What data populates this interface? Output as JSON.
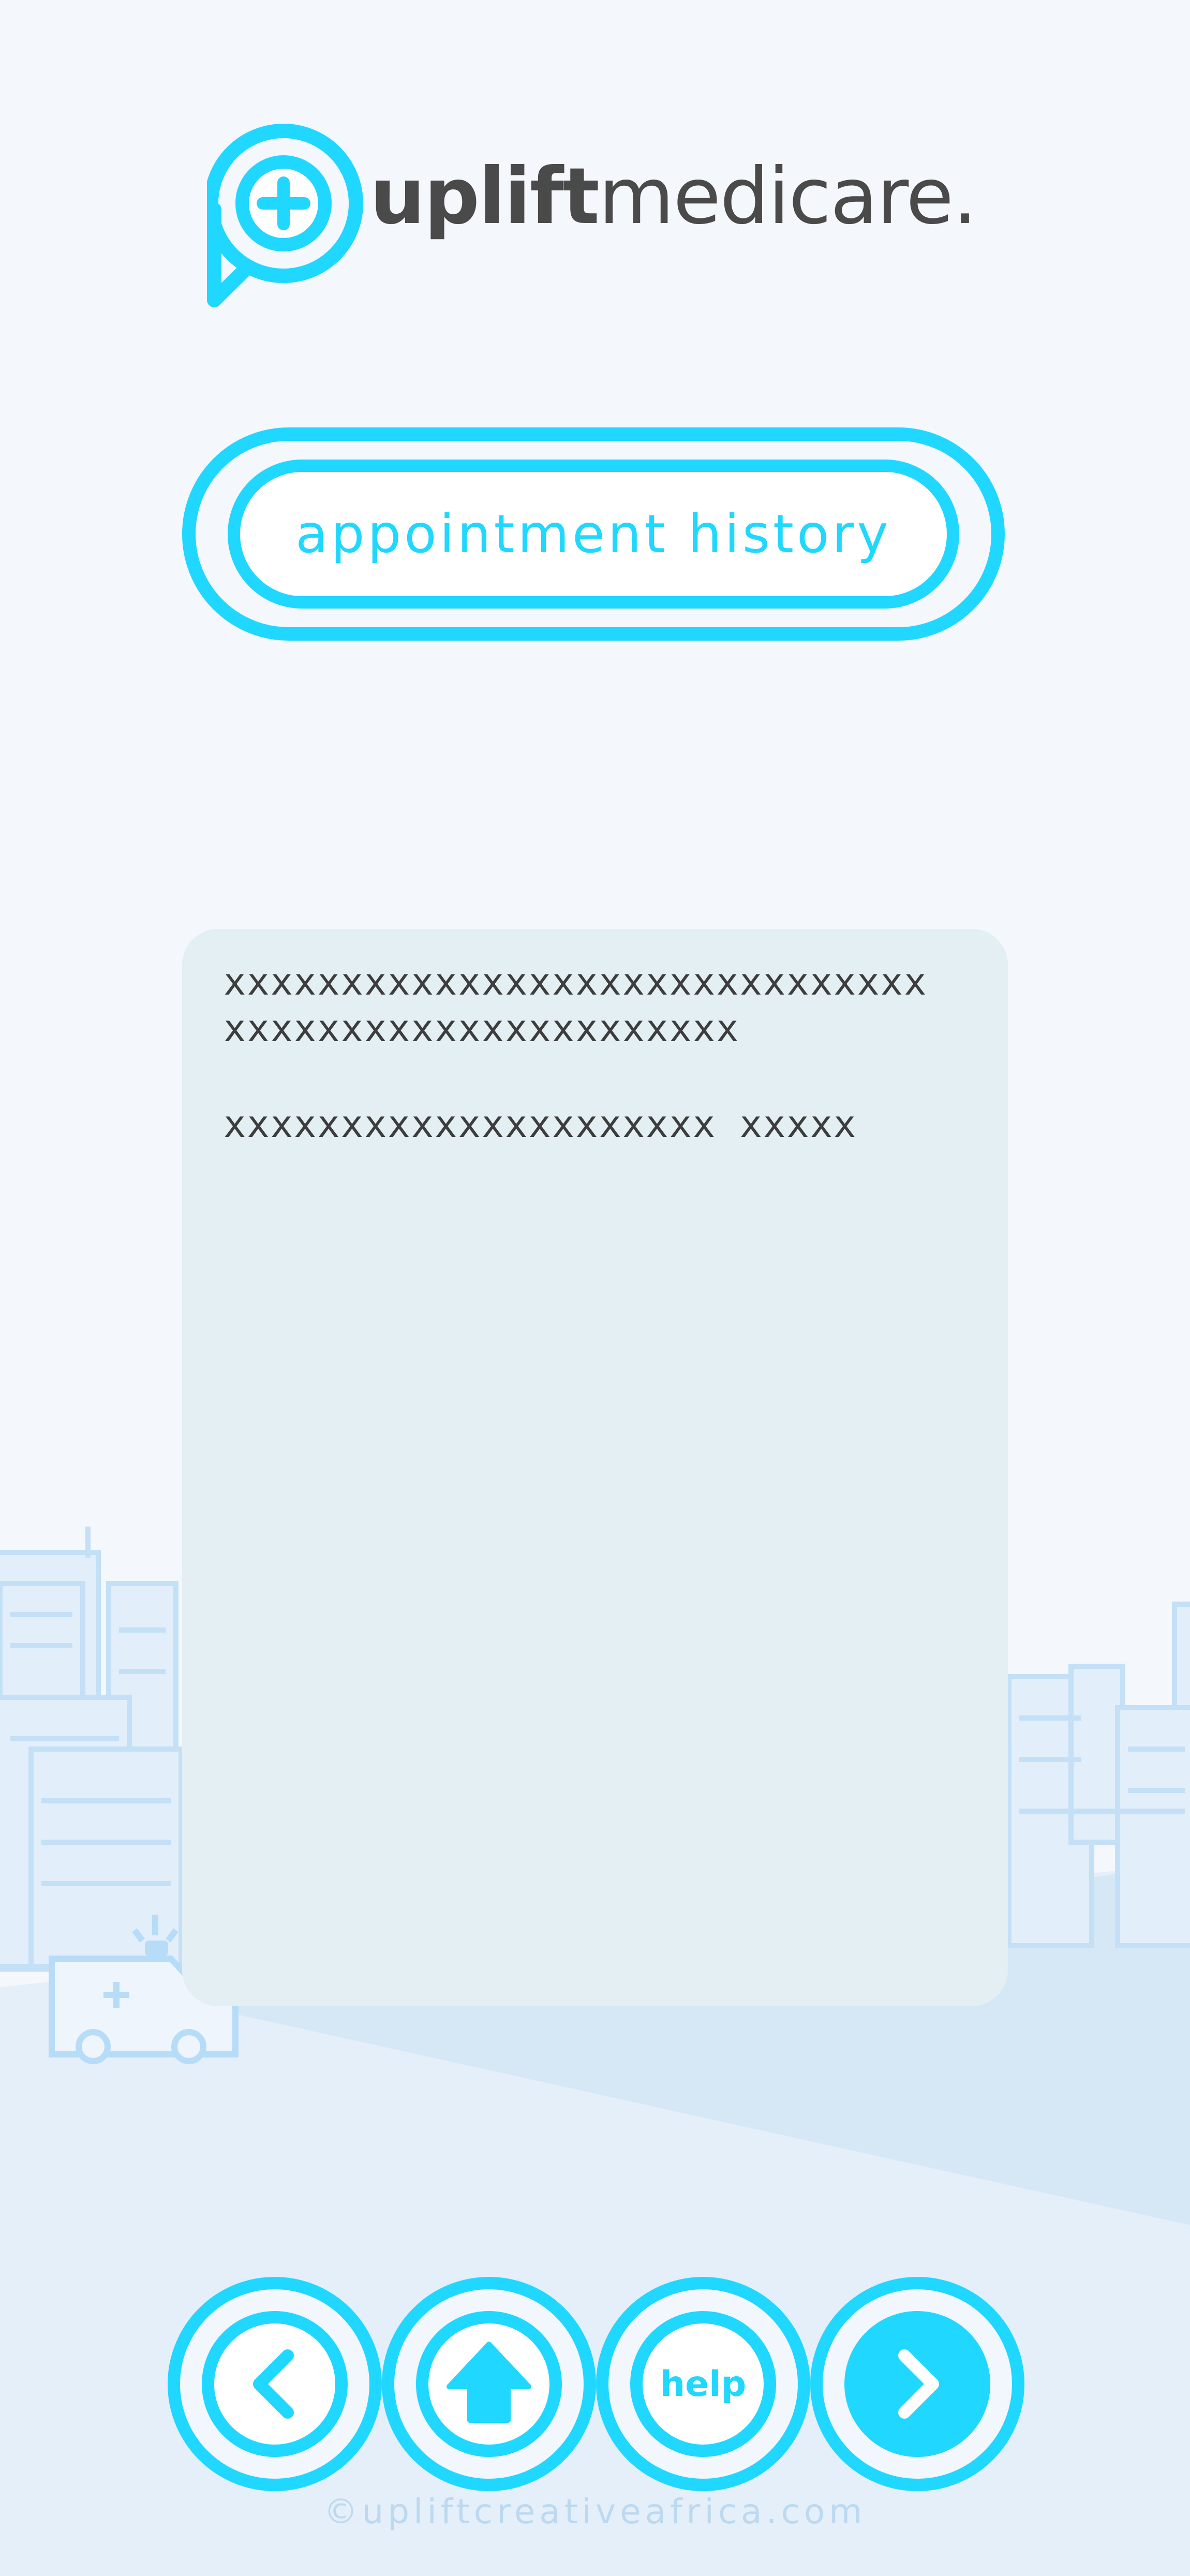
{
  "brand": {
    "bold": "uplift",
    "light": "medicare."
  },
  "header": {
    "title": "appointment history"
  },
  "content": {
    "lines": [
      "xxxxxxxxxxxxxxxxxxxxxxxxxxxxxx",
      "xxxxxxxxxxxxxxxxxxxxxx",
      "xxxxxxxxxxxxxxxxxxxxx xxxxx"
    ]
  },
  "nav": {
    "back_icon": "chevron-left-icon",
    "home_icon": "home-arrow-up-icon",
    "help_label": "help",
    "next_icon": "chevron-right-icon"
  },
  "footer": {
    "text": "©upliftcreativeafrica.com"
  },
  "colors": {
    "accent": "#20d7ff",
    "text": "#4a4a4a",
    "card": "#e3eff2",
    "background": "#f4f7fc"
  }
}
